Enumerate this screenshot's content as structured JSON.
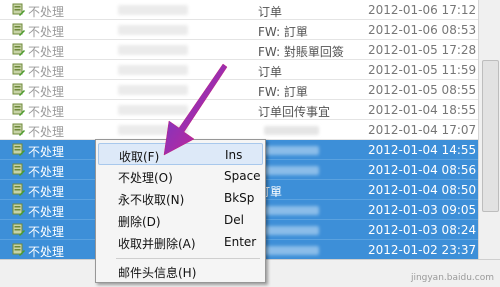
{
  "rows": [
    {
      "status": "不处理",
      "subject": "订单",
      "date": "2012-01-06 17:12",
      "selected": false
    },
    {
      "status": "不处理",
      "subject": "FW: 訂單",
      "date": "2012-01-06 08:53",
      "selected": false
    },
    {
      "status": "不处理",
      "subject": "FW: 對賬單回簽",
      "date": "2012-01-05 17:28",
      "selected": false
    },
    {
      "status": "不处理",
      "subject": "订单",
      "date": "2012-01-05 11:59",
      "selected": false
    },
    {
      "status": "不处理",
      "subject": "FW: 訂單",
      "date": "2012-01-05 08:55",
      "selected": false
    },
    {
      "status": "不处理",
      "subject": "订单回传事宜",
      "date": "2012-01-04 18:55",
      "selected": false
    },
    {
      "status": "不处理",
      "subject": "",
      "date": "2012-01-04 17:07",
      "selected": false
    },
    {
      "status": "不处理",
      "subject": "",
      "date": "2012-01-04 14:55",
      "selected": true
    },
    {
      "status": "不处理",
      "subject": "",
      "date": "2012-01-04 08:56",
      "selected": true
    },
    {
      "status": "不处理",
      "subject": "訂單",
      "date": "2012-01-04 08:50",
      "selected": true
    },
    {
      "status": "不处理",
      "subject": "",
      "date": "2012-01-03 09:05",
      "selected": true
    },
    {
      "status": "不处理",
      "subject": "",
      "date": "2012-01-03 08:24",
      "selected": true
    },
    {
      "status": "不处理",
      "subject": "",
      "date": "2012-01-02 23:37",
      "selected": true
    }
  ],
  "menu": {
    "items": [
      {
        "label": "收取(F)",
        "shortcut": "Ins"
      },
      {
        "label": "不处理(O)",
        "shortcut": "Space"
      },
      {
        "label": "永不收取(N)",
        "shortcut": "BkSp"
      },
      {
        "label": "删除(D)",
        "shortcut": "Del"
      },
      {
        "label": "收取并删除(A)",
        "shortcut": "Enter"
      },
      {
        "label": "邮件头信息(H)",
        "shortcut": ""
      }
    ]
  },
  "watermark": "jingyan.baidu.com",
  "colors": {
    "selection": "#3d8fd8",
    "arrow": "#d81e8f"
  },
  "icons": {
    "row": "mail-server-icon"
  }
}
